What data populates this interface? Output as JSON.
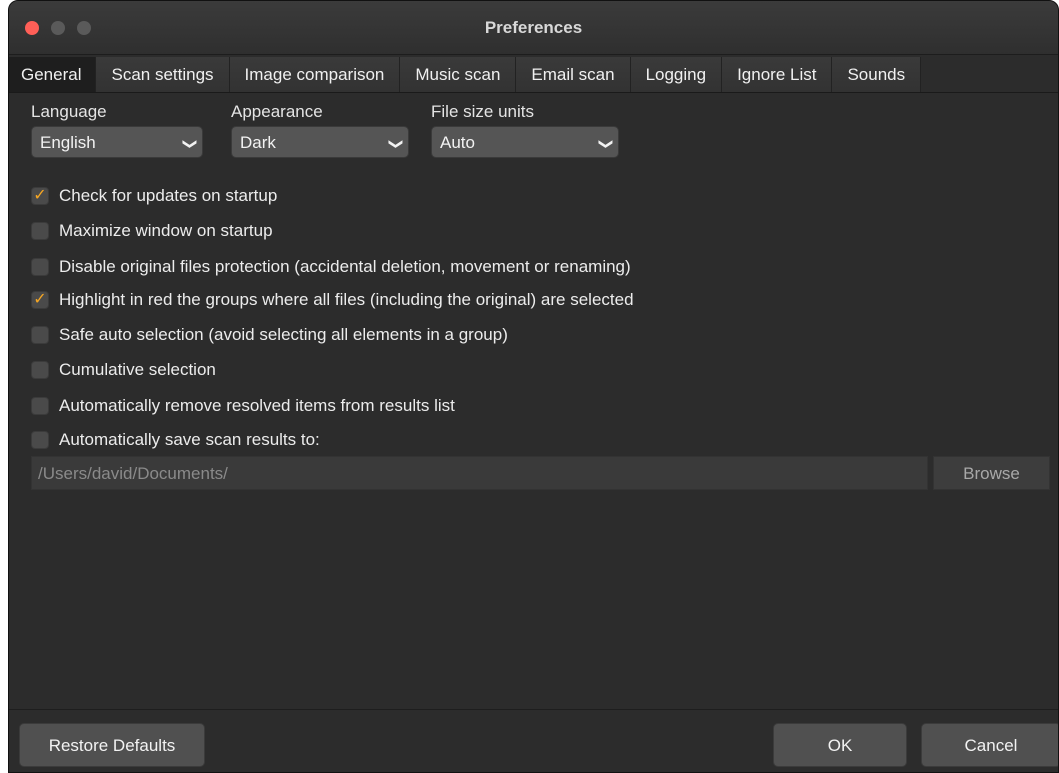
{
  "window": {
    "title": "Preferences"
  },
  "tabs": [
    {
      "label": "General",
      "active": true
    },
    {
      "label": "Scan settings"
    },
    {
      "label": "Image comparison"
    },
    {
      "label": "Music scan"
    },
    {
      "label": "Email scan"
    },
    {
      "label": "Logging"
    },
    {
      "label": "Ignore List"
    },
    {
      "label": "Sounds"
    }
  ],
  "selects": {
    "language": {
      "label": "Language",
      "value": "English"
    },
    "appearance": {
      "label": "Appearance",
      "value": "Dark"
    },
    "file_size_units": {
      "label": "File size units",
      "value": "Auto"
    }
  },
  "options": [
    {
      "label": "Check for updates on startup",
      "checked": true
    },
    {
      "label": "Maximize window on startup",
      "checked": false
    },
    {
      "label": "Disable original files protection (accidental deletion, movement or renaming)",
      "checked": false
    },
    {
      "label": "Highlight in red the groups where all files (including the original) are selected",
      "checked": true
    },
    {
      "label": "Safe auto selection (avoid selecting all elements in a group)",
      "checked": false
    },
    {
      "label": "Cumulative selection",
      "checked": false
    },
    {
      "label": "Automatically remove resolved items from results list",
      "checked": false
    },
    {
      "label": "Automatically save scan results to:",
      "checked": false
    }
  ],
  "save_path": {
    "value": "/Users/david/Documents/",
    "browse_label": "Browse"
  },
  "footer": {
    "restore_label": "Restore Defaults",
    "ok_label": "OK",
    "cancel_label": "Cancel"
  },
  "colors": {
    "check_mark": "#f5a623",
    "window_bg": "#2c2c2c",
    "close_button": "#ff5f57"
  },
  "icons": {
    "check": "checkmark-icon",
    "chevron": "chevron-down-icon"
  }
}
